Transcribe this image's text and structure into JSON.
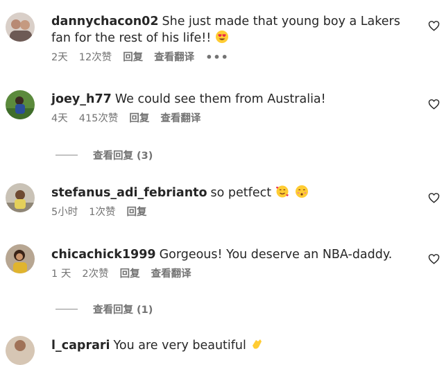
{
  "comments": [
    {
      "username": "dannychacon02",
      "text": "She just made that young boy a Lakers fan for the rest of his life!!",
      "emoji": "heart-eyes-emoji",
      "time": "2天",
      "likes": "12次赞",
      "reply": "回复",
      "translate": "查看翻译",
      "more": "•••"
    },
    {
      "username": "joey_h77",
      "text": "We could see them from Australia!",
      "time": "4天",
      "likes": "415次赞",
      "reply": "回复",
      "translate": "查看翻译",
      "view_replies": "查看回复 (3)"
    },
    {
      "username": "stefanus_adi_febrianto",
      "text": "so petfect",
      "emoji": "smiling-hearts-and-kiss-emoji",
      "time": "5小时",
      "likes": "1次赞",
      "reply": "回复"
    },
    {
      "username": "chicachick1999",
      "text": "Gorgeous! You deserve an NBA-daddy.",
      "time": "1 天",
      "likes": "2次赞",
      "reply": "回复",
      "translate": "查看翻译",
      "view_replies": "查看回复 (1)"
    },
    {
      "username": "l_caprari",
      "text": "You are very beautiful",
      "emoji": "clapping-hands-emoji"
    }
  ],
  "colors": {
    "text": "#262626",
    "secondary": "#737373",
    "emoji_yellow": "#ffcc33",
    "emoji_heart": "#e8264b"
  }
}
